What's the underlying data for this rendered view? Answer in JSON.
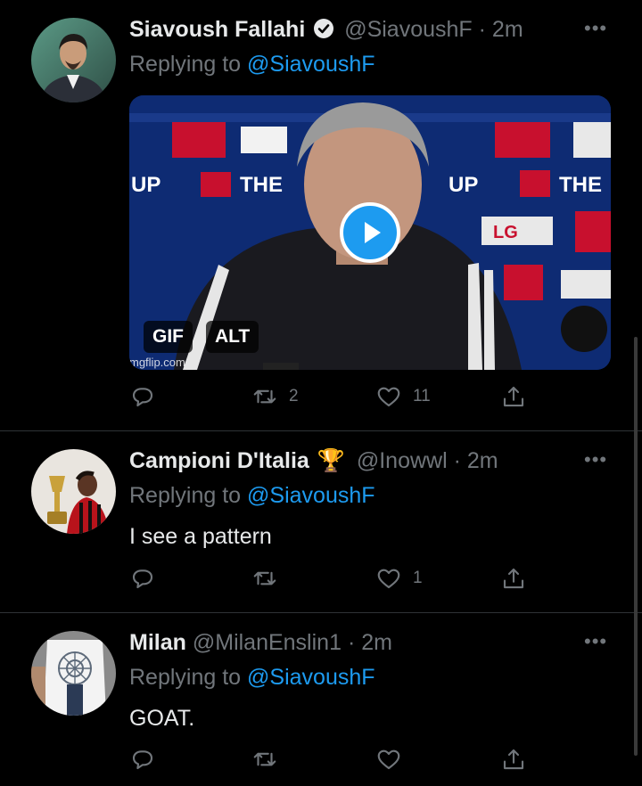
{
  "tweets": [
    {
      "name": "Siavoush Fallahi",
      "verified": true,
      "handle": "@SiavoushF",
      "time": "2m",
      "replying_prefix": "Replying to",
      "replying_to": "@SiavoushF",
      "media": {
        "badge_gif": "GIF",
        "badge_alt": "ALT",
        "watermark": "mgflip.com",
        "backdrop_text": [
          "UP",
          "THE",
          "LG",
          "UP",
          "THE"
        ]
      },
      "retweets": "2",
      "likes": "11"
    },
    {
      "name": "Campioni D'Italia",
      "emoji": "🏆",
      "handle": "@Inowwl",
      "time": "2m",
      "replying_prefix": "Replying to",
      "replying_to": "@SiavoushF",
      "text": "I see a pattern",
      "retweets": "",
      "likes": "1"
    },
    {
      "name": "Milan",
      "handle": "@MilanEnslin1",
      "time": "2m",
      "replying_prefix": "Replying to",
      "replying_to": "@SiavoushF",
      "text": "GOAT.",
      "retweets": "",
      "likes": ""
    }
  ],
  "separator": "·",
  "colors": {
    "accent": "#1d9bf0",
    "muted": "#71767b",
    "text": "#e7e9ea",
    "background": "#000000"
  }
}
